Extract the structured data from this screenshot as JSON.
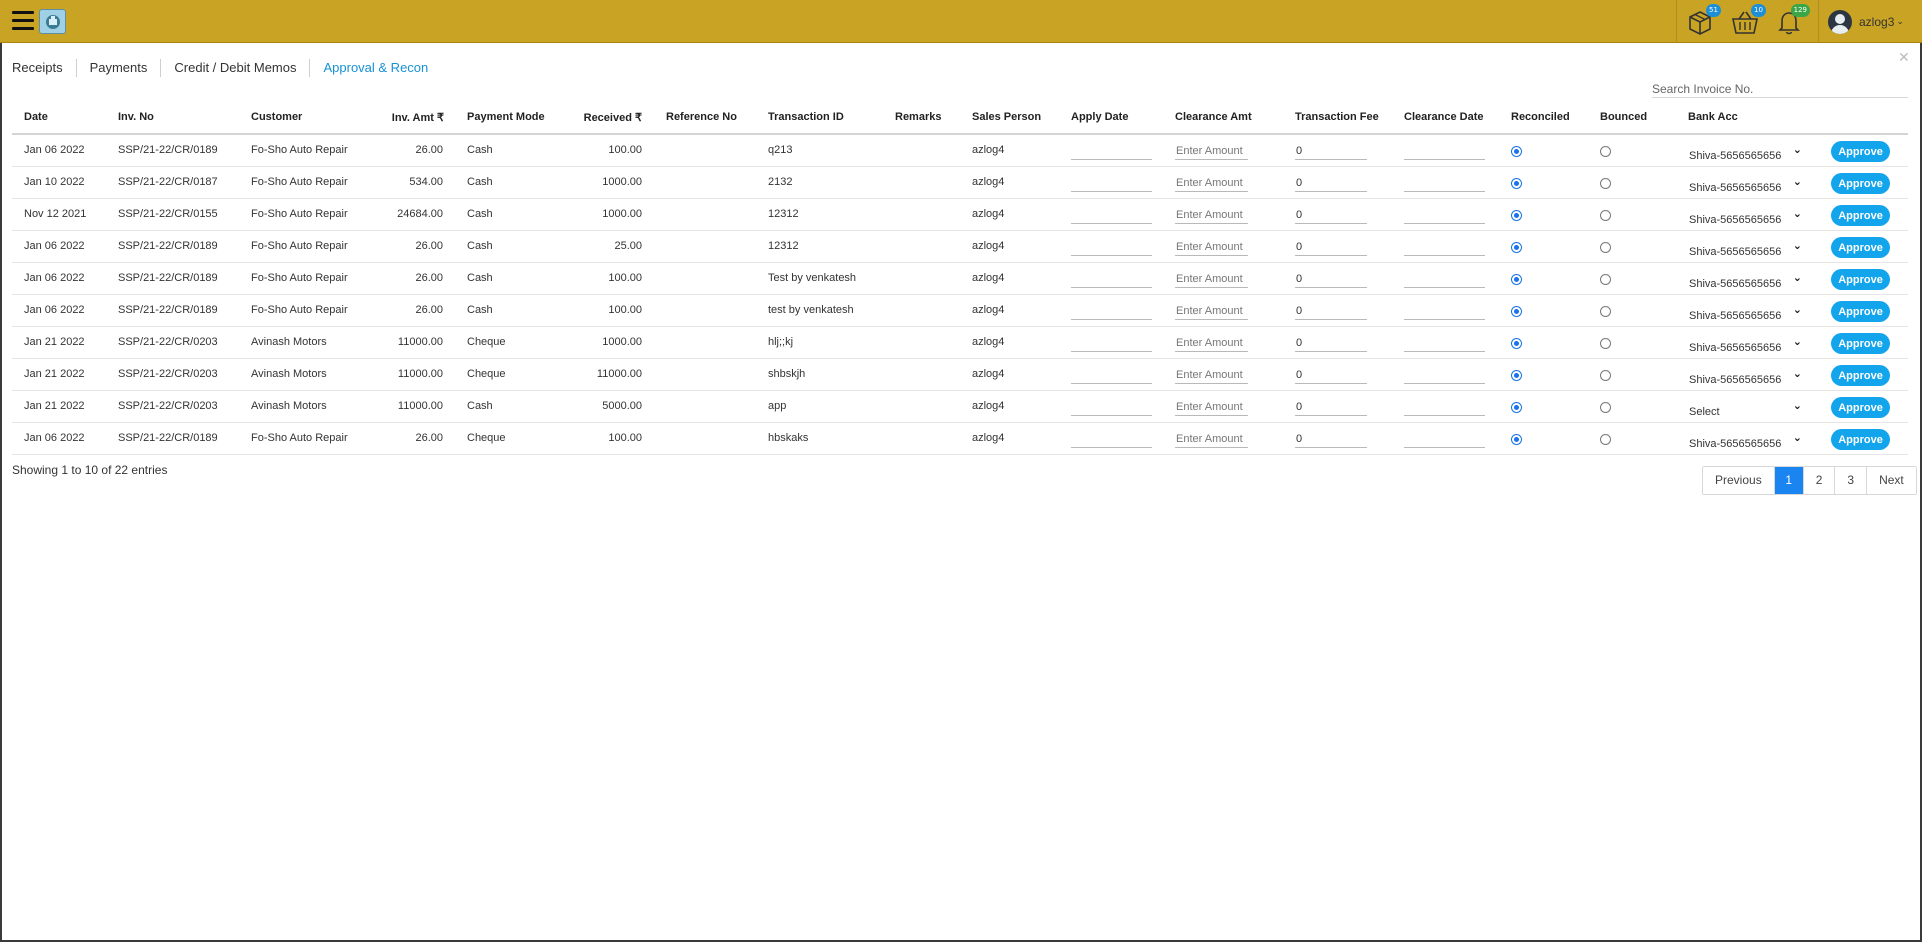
{
  "header": {
    "username": "azlog3",
    "badges": {
      "orders": "51",
      "cart": "10",
      "notifications": "129"
    },
    "colors": {
      "bar": "#c9a323",
      "orders_badge": "#1d8fd6",
      "cart_badge": "#1d8fd6",
      "notifications_badge": "#3aa648"
    }
  },
  "tabs": [
    {
      "label": "Receipts",
      "active": false
    },
    {
      "label": "Payments",
      "active": false
    },
    {
      "label": "Credit / Debit Memos",
      "active": false
    },
    {
      "label": "Approval & Recon",
      "active": true
    }
  ],
  "search": {
    "placeholder": "Search Invoice No.",
    "value": ""
  },
  "table": {
    "columns": {
      "date": "Date",
      "inv_no": "Inv. No",
      "customer": "Customer",
      "inv_amt": "Inv. Amt ₹",
      "payment_mode": "Payment Mode",
      "received": "Received ₹",
      "reference_no": "Reference No",
      "transaction_id": "Transaction ID",
      "remarks": "Remarks",
      "sales_person": "Sales Person",
      "apply_date": "Apply Date",
      "clearance_amt": "Clearance Amt",
      "transaction_fee": "Transaction Fee",
      "clearance_date": "Clearance Date",
      "reconciled": "Reconciled",
      "bounced": "Bounced",
      "bank_acc": "Bank Acc"
    },
    "clearance_placeholder": "Enter Amount",
    "approve_label": "Approve",
    "rows": [
      {
        "date": "Jan 06 2022",
        "inv_no": "SSP/21-22/CR/0189",
        "customer": "Fo-Sho Auto Repair",
        "inv_amt": "26.00",
        "payment_mode": "Cash",
        "received": "100.00",
        "reference_no": "",
        "transaction_id": "q213",
        "remarks": "",
        "sales_person": "azlog4",
        "apply_date": "",
        "clearance_amt": "",
        "transaction_fee": "0",
        "clearance_date": "",
        "reconciled": true,
        "bounced": false,
        "bank_acc": "Shiva-5656565656"
      },
      {
        "date": "Jan 10 2022",
        "inv_no": "SSP/21-22/CR/0187",
        "customer": "Fo-Sho Auto Repair",
        "inv_amt": "534.00",
        "payment_mode": "Cash",
        "received": "1000.00",
        "reference_no": "",
        "transaction_id": "2132",
        "remarks": "",
        "sales_person": "azlog4",
        "apply_date": "",
        "clearance_amt": "",
        "transaction_fee": "0",
        "clearance_date": "",
        "reconciled": true,
        "bounced": false,
        "bank_acc": "Shiva-5656565656"
      },
      {
        "date": "Nov 12 2021",
        "inv_no": "SSP/21-22/CR/0155",
        "customer": "Fo-Sho Auto Repair",
        "inv_amt": "24684.00",
        "payment_mode": "Cash",
        "received": "1000.00",
        "reference_no": "",
        "transaction_id": "12312",
        "remarks": "",
        "sales_person": "azlog4",
        "apply_date": "",
        "clearance_amt": "",
        "transaction_fee": "0",
        "clearance_date": "",
        "reconciled": true,
        "bounced": false,
        "bank_acc": "Shiva-5656565656"
      },
      {
        "date": "Jan 06 2022",
        "inv_no": "SSP/21-22/CR/0189",
        "customer": "Fo-Sho Auto Repair",
        "inv_amt": "26.00",
        "payment_mode": "Cash",
        "received": "25.00",
        "reference_no": "",
        "transaction_id": "12312",
        "remarks": "",
        "sales_person": "azlog4",
        "apply_date": "",
        "clearance_amt": "",
        "transaction_fee": "0",
        "clearance_date": "",
        "reconciled": true,
        "bounced": false,
        "bank_acc": "Shiva-5656565656"
      },
      {
        "date": "Jan 06 2022",
        "inv_no": "SSP/21-22/CR/0189",
        "customer": "Fo-Sho Auto Repair",
        "inv_amt": "26.00",
        "payment_mode": "Cash",
        "received": "100.00",
        "reference_no": "",
        "transaction_id": "Test by venkatesh",
        "remarks": "",
        "sales_person": "azlog4",
        "apply_date": "",
        "clearance_amt": "",
        "transaction_fee": "0",
        "clearance_date": "",
        "reconciled": true,
        "bounced": false,
        "bank_acc": "Shiva-5656565656"
      },
      {
        "date": "Jan 06 2022",
        "inv_no": "SSP/21-22/CR/0189",
        "customer": "Fo-Sho Auto Repair",
        "inv_amt": "26.00",
        "payment_mode": "Cash",
        "received": "100.00",
        "reference_no": "",
        "transaction_id": "test by venkatesh",
        "remarks": "",
        "sales_person": "azlog4",
        "apply_date": "",
        "clearance_amt": "",
        "transaction_fee": "0",
        "clearance_date": "",
        "reconciled": true,
        "bounced": false,
        "bank_acc": "Shiva-5656565656"
      },
      {
        "date": "Jan 21 2022",
        "inv_no": "SSP/21-22/CR/0203",
        "customer": "Avinash Motors",
        "inv_amt": "11000.00",
        "payment_mode": "Cheque",
        "received": "1000.00",
        "reference_no": "",
        "transaction_id": "hlj;;kj",
        "remarks": "",
        "sales_person": "azlog4",
        "apply_date": "",
        "clearance_amt": "",
        "transaction_fee": "0",
        "clearance_date": "",
        "reconciled": true,
        "bounced": false,
        "bank_acc": "Shiva-5656565656"
      },
      {
        "date": "Jan 21 2022",
        "inv_no": "SSP/21-22/CR/0203",
        "customer": "Avinash Motors",
        "inv_amt": "11000.00",
        "payment_mode": "Cheque",
        "received": "11000.00",
        "reference_no": "",
        "transaction_id": "shbskjh",
        "remarks": "",
        "sales_person": "azlog4",
        "apply_date": "",
        "clearance_amt": "",
        "transaction_fee": "0",
        "clearance_date": "",
        "reconciled": true,
        "bounced": false,
        "bank_acc": "Shiva-5656565656"
      },
      {
        "date": "Jan 21 2022",
        "inv_no": "SSP/21-22/CR/0203",
        "customer": "Avinash Motors",
        "inv_amt": "11000.00",
        "payment_mode": "Cash",
        "received": "5000.00",
        "reference_no": "",
        "transaction_id": "app",
        "remarks": "",
        "sales_person": "azlog4",
        "apply_date": "",
        "clearance_amt": "",
        "transaction_fee": "0",
        "clearance_date": "",
        "reconciled": true,
        "bounced": false,
        "bank_acc": "Select"
      },
      {
        "date": "Jan 06 2022",
        "inv_no": "SSP/21-22/CR/0189",
        "customer": "Fo-Sho Auto Repair",
        "inv_amt": "26.00",
        "payment_mode": "Cheque",
        "received": "100.00",
        "reference_no": "",
        "transaction_id": "hbskaks",
        "remarks": "",
        "sales_person": "azlog4",
        "apply_date": "",
        "clearance_amt": "",
        "transaction_fee": "0",
        "clearance_date": "",
        "reconciled": true,
        "bounced": false,
        "bank_acc": "Shiva-5656565656"
      }
    ]
  },
  "footer": {
    "showing": "Showing 1 to 10 of 22 entries",
    "pagination": {
      "previous": "Previous",
      "pages": [
        "1",
        "2",
        "3"
      ],
      "current": "1",
      "next": "Next"
    }
  }
}
